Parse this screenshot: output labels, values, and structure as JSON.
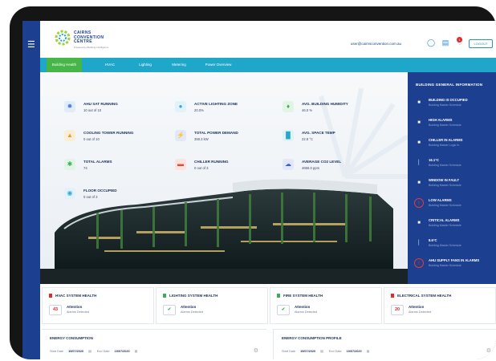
{
  "app": {
    "logo_lines": [
      "CAIRNS",
      "CONVENTION",
      "CENTRE"
    ],
    "logo_tagline": "Powered by Building Intelligence",
    "user_email": "user@cairnsconvention.com.au",
    "bell_count": "1",
    "logout_label": "LOGOUT"
  },
  "nav": {
    "tabs": [
      "Building Health",
      "HVAC",
      "Lighting",
      "Metering",
      "Power Overview"
    ]
  },
  "kpis": [
    {
      "title": "AHU SAT RUNNING",
      "value": "10 out of 10",
      "icon": "fan-icon",
      "color": "#4a7fd6",
      "bg": "#e1ebfa"
    },
    {
      "title": "ACTIVE LIGHTING ZONE",
      "value": "20.0%",
      "icon": "bulb-icon",
      "color": "#3ba7d8",
      "bg": "#e1f2fa"
    },
    {
      "title": "AVG. BUILDING HUMIDITY",
      "value": "46.0 %",
      "icon": "droplet-icon",
      "color": "#3cae5a",
      "bg": "#e2f4e6"
    },
    {
      "title": "COOLING TOWER RUNNING",
      "value": "0 out of 10",
      "icon": "tower-icon",
      "color": "#e89b2f",
      "bg": "#fbeed9"
    },
    {
      "title": "TOTAL POWER DEMAND",
      "value": "359.3 kW",
      "icon": "bolt-icon",
      "color": "#3a5ed1",
      "bg": "#e2e8fa"
    },
    {
      "title": "AVG. SPACE TEMP",
      "value": "22.8 °C",
      "icon": "thermometer-icon",
      "color": "#2aa6c9",
      "bg": "#dff2f8"
    },
    {
      "title": "TOTAL ALARMS",
      "value": "74",
      "icon": "alarm-icon",
      "color": "#3cae5a",
      "bg": "#e2f4e6"
    },
    {
      "title": "CHILLER RUNNING",
      "value": "0 out of 3",
      "icon": "chiller-icon",
      "color": "#e04a3c",
      "bg": "#fbe3df"
    },
    {
      "title": "AVERAGE CO2 LEVEL",
      "value": "4666.0 ppm",
      "icon": "cloud-icon",
      "color": "#3a5ed1",
      "bg": "#e2e8fa"
    },
    {
      "title": "FLOOR OCCUPIED",
      "value": "0 out of 3",
      "icon": "floor-icon",
      "color": "#3ba7d8",
      "bg": "#e1f2fa"
    }
  ],
  "info_panel": {
    "title": "BUILDING GENERAL INFORMATION",
    "items": [
      {
        "label": "BUILDING IS OCCUPIED",
        "sub": "Building Master Schedule",
        "icon": "building-icon",
        "alert": false
      },
      {
        "label": "HIGH ALARMS",
        "sub": "Building Master Schedule",
        "icon": "bell-icon",
        "alert": false
      },
      {
        "label": "CHILLER IN ALARMS",
        "sub": "Building Master Logic In",
        "icon": "chiller-icon",
        "alert": false
      },
      {
        "label": "16.1°C",
        "sub": "Building Master Schedule",
        "icon": "thermometer-icon",
        "alert": false
      },
      {
        "label": "WINDOW IN FAULT",
        "sub": "Building Master Schedule",
        "icon": "window-icon",
        "alert": false
      },
      {
        "label": "LOW ALARMS",
        "sub": "Building Master Schedule",
        "icon": "alert-icon",
        "alert": true
      },
      {
        "label": "CRITICAL ALARMS",
        "sub": "Building Master Schedule",
        "icon": "bell-icon",
        "alert": false
      },
      {
        "label": "8.6°C",
        "sub": "Building Master Schedule",
        "icon": "thermometer-icon",
        "alert": false
      },
      {
        "label": "AHU SUPPLY FANS IN ALARMS",
        "sub": "Building Master Schedule",
        "icon": "alert-icon",
        "alert": true
      }
    ]
  },
  "health": [
    {
      "title": "HVAC SYSTEM HEALTH",
      "badge": "43",
      "badge_color": "#e02b2b",
      "status": "Attention",
      "sub": "Alarms Detected",
      "dot": "#e02b2b"
    },
    {
      "title": "LIGHTING SYSTEM HEALTH",
      "badge": "✔",
      "badge_color": "#3cae5a",
      "status": "Attention",
      "sub": "Alarms Detected",
      "dot": "#3cae5a"
    },
    {
      "title": "FIRE SYSTEM HEALTH",
      "badge": "✔",
      "badge_color": "#3cae5a",
      "status": "Attention",
      "sub": "Alarms Detected",
      "dot": "#3cae5a"
    },
    {
      "title": "ELECTRICAL SYSTEM HEALTH",
      "badge": "20",
      "badge_color": "#e02b2b",
      "status": "Attention",
      "sub": "Alarms Detected",
      "dot": "#e02b2b"
    }
  ],
  "energy": [
    {
      "title": "ENERGY CONSUMPTION",
      "from_label": "Start Date",
      "from": "19/07/2020",
      "to_label": "End Date",
      "to": "19/07/2020"
    },
    {
      "title": "ENERGY CONSUMPTION PROFILE",
      "from_label": "Start Date",
      "from": "19/07/2020",
      "to_label": "End Date",
      "to": "19/07/2020"
    }
  ],
  "colors": {
    "navy": "#1d3f8f",
    "teal": "#1fa7c9",
    "green": "#46b648"
  }
}
